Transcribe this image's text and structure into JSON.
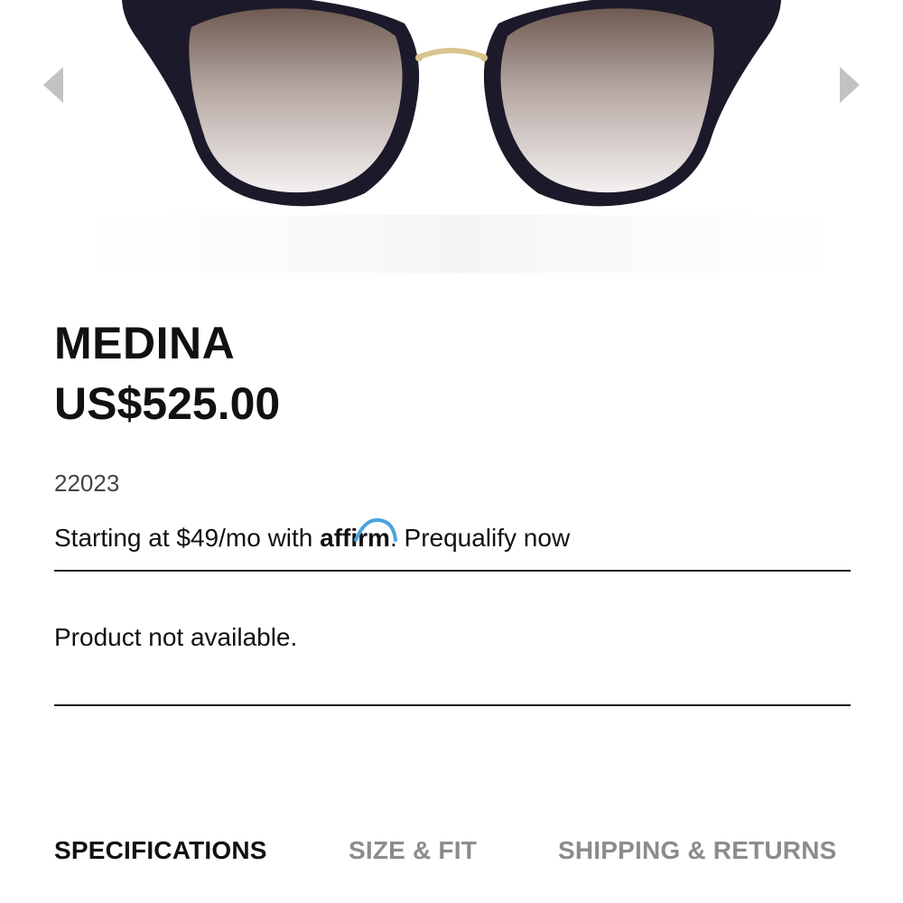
{
  "product": {
    "name": "MEDINA",
    "price": "US$525.00",
    "sku": "22023"
  },
  "financing": {
    "prefix": "Starting at $49/mo with",
    "brand": "affirm",
    "suffix": ".",
    "link": "Prequalify now"
  },
  "availability": {
    "message": "Product not available."
  },
  "carousel": {
    "prev_icon": "chevron-left-icon",
    "next_icon": "chevron-right-icon"
  },
  "tabs": [
    {
      "label": "SPECIFICATIONS",
      "active": true
    },
    {
      "label": "SIZE & FIT",
      "active": false
    },
    {
      "label": "SHIPPING & RETURNS",
      "active": false
    }
  ],
  "colors": {
    "text": "#111111",
    "muted": "#8c8c8c",
    "affirm_blue": "#4aa3df",
    "frame": "#1c1a2a",
    "temple": "#c8b68a"
  }
}
